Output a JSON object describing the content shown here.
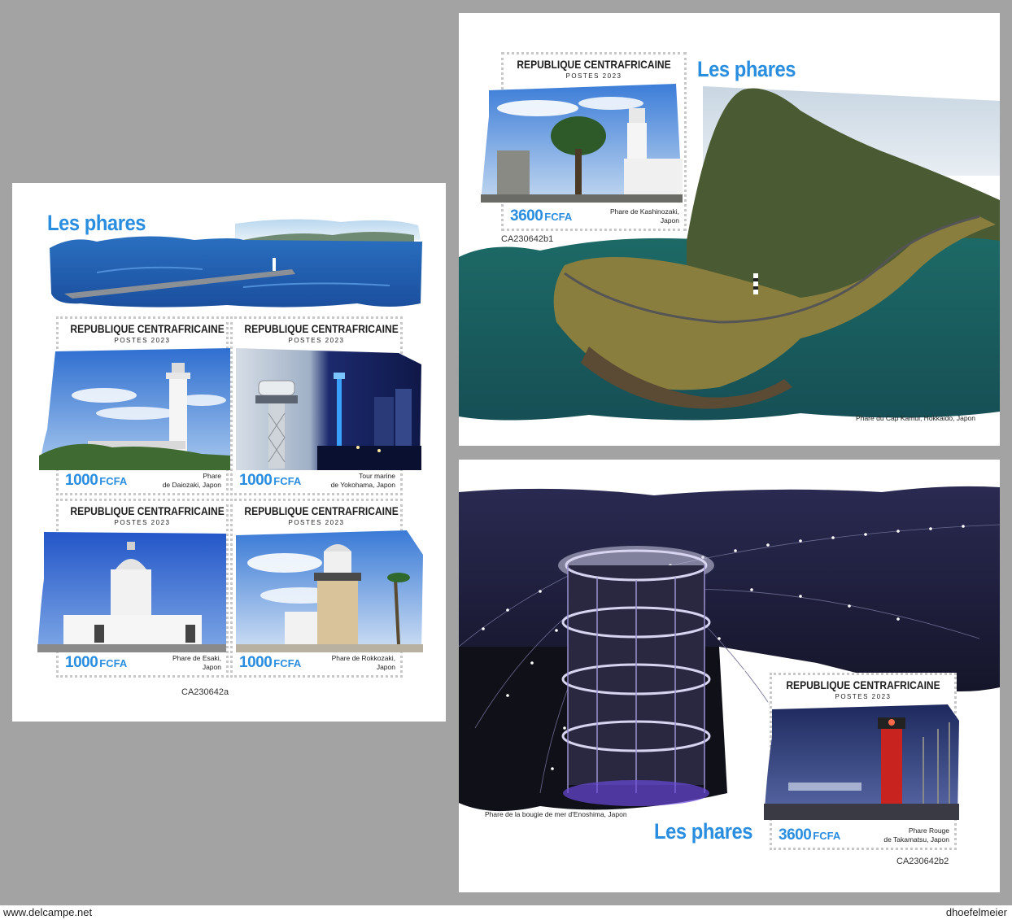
{
  "sheet_a": {
    "title": "Les phares",
    "code": "CA230642a",
    "stamps": [
      {
        "country": "REPUBLIQUE CENTRAFRICAINE",
        "postes": "POSTES 2023",
        "value": "1000",
        "currency": "FCFA",
        "caption": "Phare\nde Daiozaki, Japon"
      },
      {
        "country": "REPUBLIQUE CENTRAFRICAINE",
        "postes": "POSTES 2023",
        "value": "1000",
        "currency": "FCFA",
        "caption": "Tour marine\nde Yokohama, Japon"
      },
      {
        "country": "REPUBLIQUE CENTRAFRICAINE",
        "postes": "POSTES 2023",
        "value": "1000",
        "currency": "FCFA",
        "caption": "Phare de Esaki,\nJapon"
      },
      {
        "country": "REPUBLIQUE CENTRAFRICAINE",
        "postes": "POSTES 2023",
        "value": "1000",
        "currency": "FCFA",
        "caption": "Phare de Rokkozaki,\nJapon"
      }
    ]
  },
  "sheet_b1": {
    "title": "Les phares",
    "code": "CA230642b1",
    "background_caption": "Phare du Cap Kamui, Hokkaido, Japon",
    "stamp": {
      "country": "REPUBLIQUE CENTRAFRICAINE",
      "postes": "POSTES 2023",
      "value": "3600",
      "currency": "FCFA",
      "caption": "Phare de Kashinozaki,\nJapon"
    }
  },
  "sheet_b2": {
    "title": "Les phares",
    "code": "CA230642b2",
    "background_caption": "Phare de la bougie de mer d'Enoshima, Japon",
    "stamp": {
      "country": "REPUBLIQUE CENTRAFRICAINE",
      "postes": "POSTES 2023",
      "value": "3600",
      "currency": "FCFA",
      "caption": "Phare Rouge\nde Takamatsu, Japon"
    }
  },
  "watermark": {
    "left": "www.delcampe.net",
    "right": "dhoefelmeier"
  },
  "colors": {
    "accent_blue": "#2a8ee0",
    "background": "#a3a3a3"
  }
}
